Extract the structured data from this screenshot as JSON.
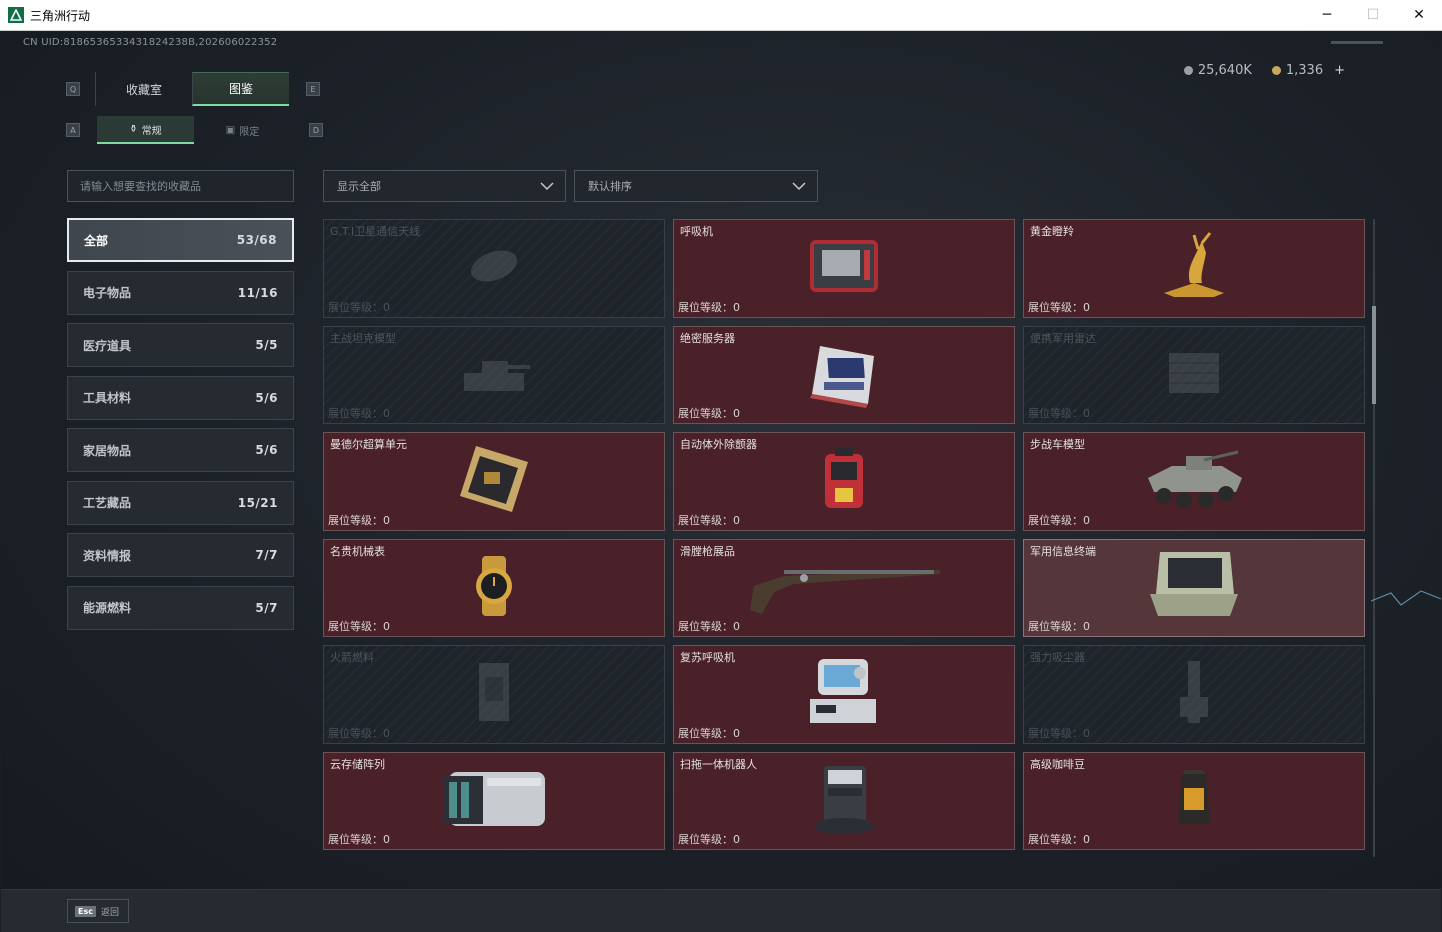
{
  "window": {
    "title": "三角洲行动",
    "controls": [
      "─",
      "☐",
      "✕"
    ]
  },
  "header": {
    "uid": "CN UID:8186536533431824238B,202606022352",
    "currency": {
      "silver": "25,640K",
      "gold": "1,336",
      "add": "+"
    }
  },
  "keys": {
    "q": "Q",
    "e": "E",
    "a": "A",
    "d": "D"
  },
  "main_tabs": [
    {
      "label": "收藏室"
    },
    {
      "label": "图鉴",
      "active": true
    }
  ],
  "sub_tabs": [
    {
      "label": "常规",
      "icon": "vase-icon",
      "active": true
    },
    {
      "label": "限定",
      "icon": "frame-icon"
    }
  ],
  "search": {
    "placeholder": "请输入想要查找的收藏品"
  },
  "categories": [
    {
      "label": "全部",
      "count": "53/68",
      "active": true
    },
    {
      "label": "电子物品",
      "count": "11/16"
    },
    {
      "label": "医疗道具",
      "count": "5/5"
    },
    {
      "label": "工具材料",
      "count": "5/6"
    },
    {
      "label": "家居物品",
      "count": "5/6"
    },
    {
      "label": "工艺藏品",
      "count": "15/21"
    },
    {
      "label": "资料情报",
      "count": "7/7"
    },
    {
      "label": "能源燃料",
      "count": "5/7"
    }
  ],
  "filters": {
    "show": "显示全部",
    "sort": "默认排序"
  },
  "level_label": "展位等级：",
  "items": [
    {
      "name": "G.T.I卫星通信天线",
      "level": "0",
      "locked": true,
      "icon": "satellite-dish-icon"
    },
    {
      "name": "呼吸机",
      "level": "0",
      "icon": "ventilator-icon"
    },
    {
      "name": "黄金瞪羚",
      "level": "0",
      "icon": "golden-gazelle-icon"
    },
    {
      "name": "主战坦克模型",
      "level": "0",
      "locked": true,
      "icon": "tank-model-icon"
    },
    {
      "name": "绝密服务器",
      "level": "0",
      "icon": "server-icon"
    },
    {
      "name": "便携军用雷达",
      "level": "0",
      "locked": true,
      "icon": "radar-icon"
    },
    {
      "name": "曼德尔超算单元",
      "level": "0",
      "icon": "compute-unit-icon"
    },
    {
      "name": "自动体外除颤器",
      "level": "0",
      "icon": "defibrillator-icon"
    },
    {
      "name": "步战车模型",
      "level": "0",
      "icon": "ifv-model-icon"
    },
    {
      "name": "名贵机械表",
      "level": "0",
      "icon": "watch-icon"
    },
    {
      "name": "滑膛枪展品",
      "level": "0",
      "icon": "musket-icon"
    },
    {
      "name": "军用信息终端",
      "level": "0",
      "highlight": true,
      "icon": "military-terminal-icon"
    },
    {
      "name": "火箭燃料",
      "level": "0",
      "locked": true,
      "icon": "rocket-fuel-icon"
    },
    {
      "name": "复苏呼吸机",
      "level": "0",
      "icon": "resuscitator-icon"
    },
    {
      "name": "强力吸尘器",
      "level": "0",
      "locked": true,
      "icon": "vacuum-icon"
    },
    {
      "name": "云存储阵列",
      "level": "0",
      "icon": "storage-array-icon"
    },
    {
      "name": "扫拖一体机器人",
      "level": "0",
      "icon": "robot-vacuum-icon"
    },
    {
      "name": "高级咖啡豆",
      "level": "0",
      "icon": "coffee-bag-icon"
    }
  ],
  "footer": {
    "esc_key": "Esc",
    "esc_label": "返回"
  },
  "colors": {
    "accent": "#7fdca0",
    "card_owned": "#4a2128",
    "card_border": "#6a5458"
  }
}
